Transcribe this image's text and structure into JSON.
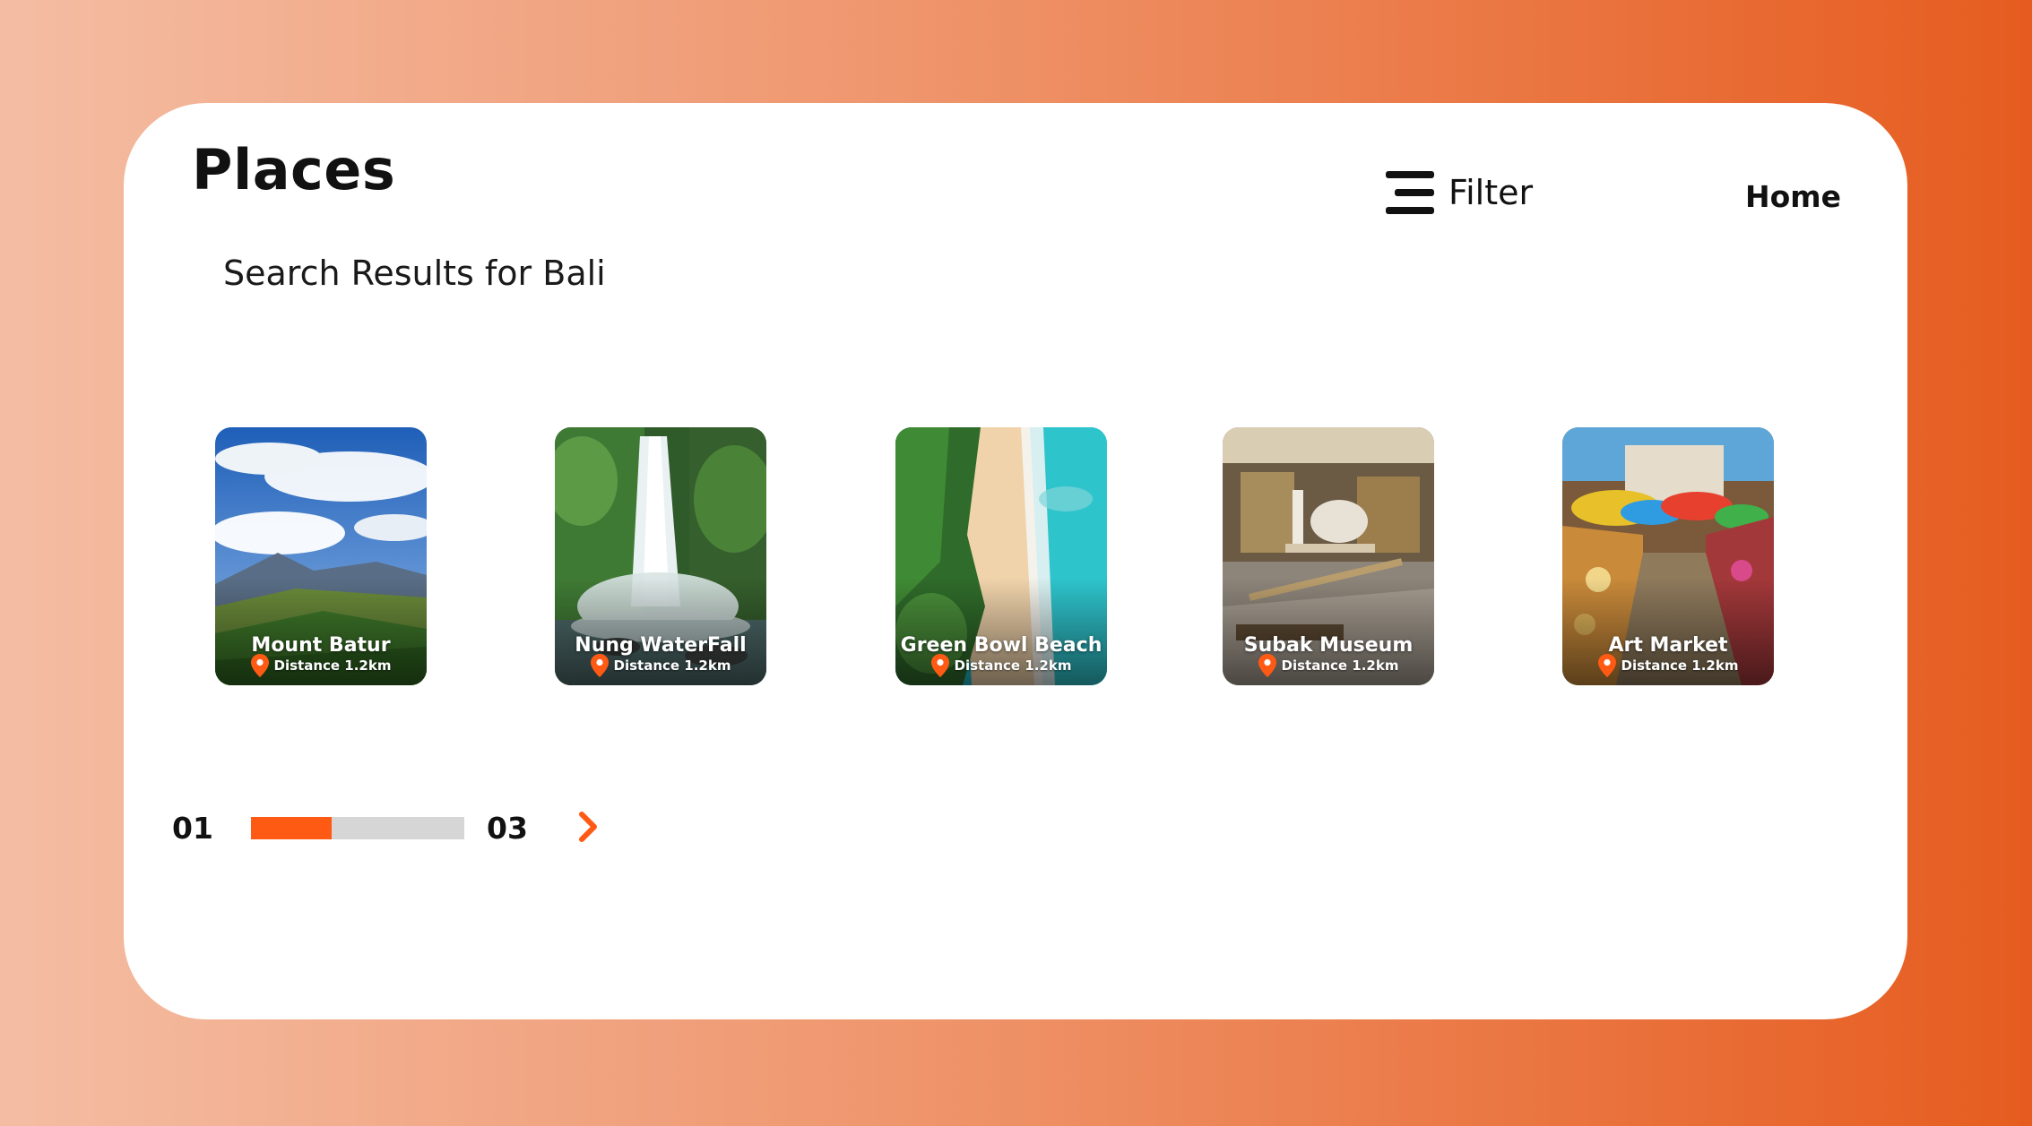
{
  "header": {
    "title": "Places",
    "subtitle": "Search Results for Bali",
    "filter_label": "Filter",
    "home_label": "Home"
  },
  "places": [
    {
      "name": "Mount Batur",
      "distance": "Distance 1.2km"
    },
    {
      "name": "Nung WaterFall",
      "distance": "Distance 1.2km"
    },
    {
      "name": "Green Bowl Beach",
      "distance": "Distance 1.2km"
    },
    {
      "name": "Subak Museum",
      "distance": "Distance 1.2km"
    },
    {
      "name": "Art Market",
      "distance": "Distance 1.2km"
    }
  ],
  "pager": {
    "current": "01",
    "total": "03",
    "progress": 0.38
  },
  "colors": {
    "accent": "#ff5a14",
    "pin": "#ff5a14",
    "track": "#d6d6d6"
  },
  "icons": {
    "filter": "filter-icon",
    "pin": "location-pin-icon",
    "next": "chevron-right-icon"
  }
}
